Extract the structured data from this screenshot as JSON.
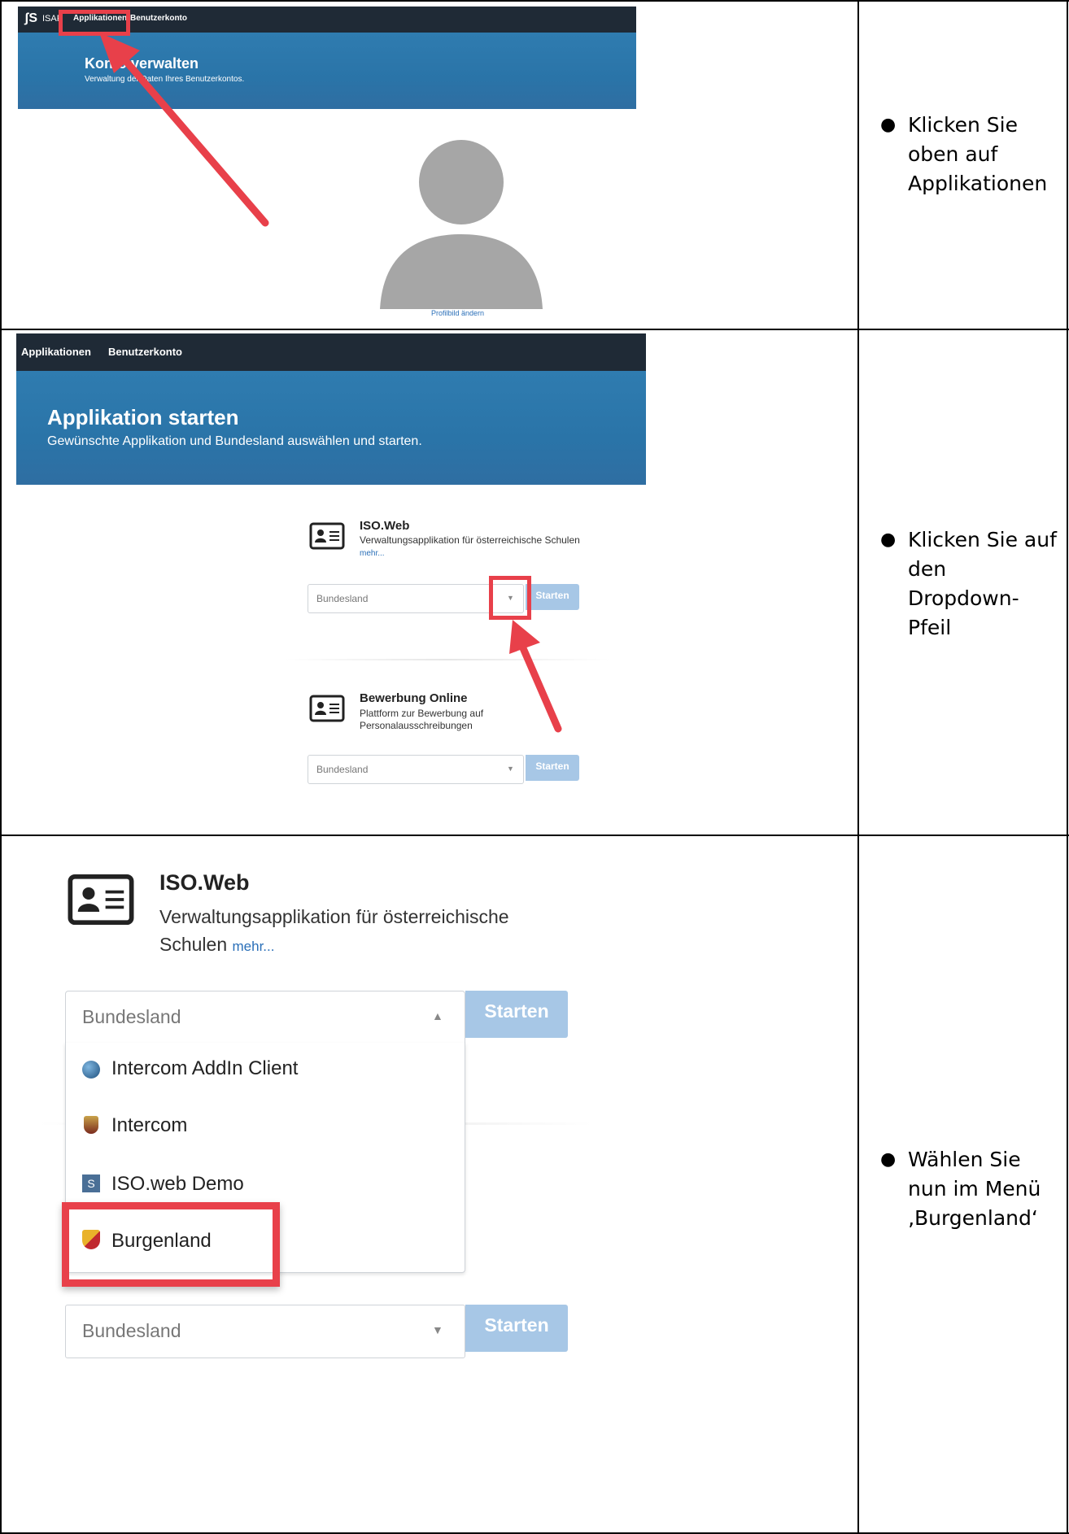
{
  "panel1": {
    "nav": {
      "brand": "ISAF",
      "tab_apps": "Applikationen",
      "tab_account": "Benutzerkonto"
    },
    "hero_title": "Konto verwalten",
    "hero_subtitle": "Verwaltung der Daten Ihres Benutzerkontos.",
    "profile_link": "Profilbild ändern"
  },
  "panel2": {
    "nav": {
      "tab_apps": "Applikationen",
      "tab_account": "Benutzerkonto"
    },
    "hero_title": "Applikation starten",
    "hero_subtitle": "Gewünschte Applikation und Bundesland auswählen und starten.",
    "apps": [
      {
        "name": "ISO.Web",
        "desc": "Verwaltungsapplikation für österreichische Schulen",
        "more": "mehr...",
        "placeholder": "Bundesland",
        "start": "Starten"
      },
      {
        "name": "Bewerbung Online",
        "desc": "Plattform zur Bewerbung auf Personalausschreibungen",
        "placeholder": "Bundesland",
        "start": "Starten"
      }
    ]
  },
  "panel3": {
    "app_name": "ISO.Web",
    "desc_line1": "Verwaltungsapplikation für österreichische",
    "desc_line2": "Schulen",
    "more": "mehr...",
    "placeholder": "Bundesland",
    "start": "Starten",
    "options": [
      "Intercom AddIn Client",
      "Intercom",
      "ISO.web Demo",
      "Burgenland"
    ],
    "second_placeholder": "Bundesland",
    "second_start": "Starten"
  },
  "instructions": [
    "Klicken Sie oben auf Applikationen",
    "Klicken Sie auf den Dropdown-Pfeil",
    "Wählen Sie nun im Menü ‚Burgenland‘"
  ],
  "colors": {
    "highlight": "#e8404a",
    "navbar": "#1f2a36",
    "hero": "#2f7cb0",
    "start_button": "#a7c7e6"
  }
}
